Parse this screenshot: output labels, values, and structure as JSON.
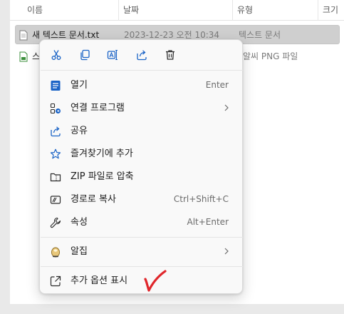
{
  "columns": {
    "name": "이름",
    "date": "날짜",
    "type": "유형",
    "size": "크기"
  },
  "files": [
    {
      "name": "새 텍스트 문서.txt",
      "date": "2023-12-23 오전 10:34",
      "type": "텍스트 문서"
    },
    {
      "name_partial": "스",
      "type_partial": "알씨 PNG 파일"
    }
  ],
  "toolbar": {
    "cut_icon": "scissors-icon",
    "copy_icon": "copy-icon",
    "rename_icon": "rename-icon",
    "share_icon": "share-icon",
    "delete_icon": "trash-icon"
  },
  "menu": {
    "open": {
      "label": "열기",
      "shortcut": "Enter"
    },
    "open_with": {
      "label": "연결 프로그램"
    },
    "share": {
      "label": "공유"
    },
    "favorites": {
      "label": "즐겨찾기에 추가"
    },
    "zip": {
      "label": "ZIP 파일로 압축"
    },
    "copy_path": {
      "label": "경로로 복사",
      "shortcut": "Ctrl+Shift+C"
    },
    "properties": {
      "label": "속성",
      "shortcut": "Alt+Enter"
    },
    "alzip": {
      "label": "알집"
    },
    "more_options": {
      "label": "추가 옵션 표시"
    }
  },
  "colors": {
    "accent": "#1a63c6",
    "check_mark": "#e0262b"
  }
}
